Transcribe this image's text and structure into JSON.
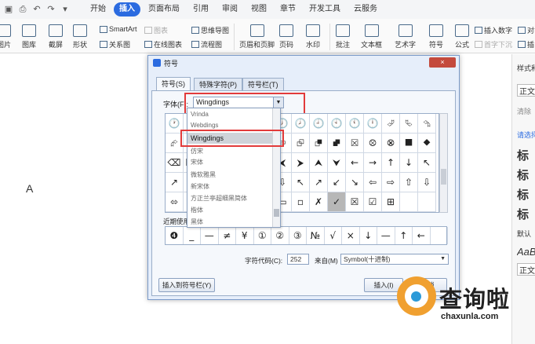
{
  "menubar": {
    "tabs": [
      "开始",
      "插入",
      "页面布局",
      "引用",
      "审阅",
      "视图",
      "章节",
      "开发工具",
      "云服务"
    ],
    "active_tab": "插入"
  },
  "ribbon": {
    "picture": "图片",
    "gallery": "图库",
    "screenshot": "截屏",
    "shape": "形状",
    "smartart": "SmartArt",
    "chart": "图表",
    "relation_chart": "关系图",
    "online_chart": "在线图表",
    "mindmap": "思维导图",
    "flowchart": "流程图",
    "header_footer": "页眉和页脚",
    "page_number": "页码",
    "watermark": "水印",
    "comment": "批注",
    "textbox": "文本框",
    "wordart": "艺术字",
    "symbol": "符号",
    "formula": "公式",
    "insert_number": "插入数字",
    "attachment": "对象",
    "first_drop": "首字下沉",
    "bookmark": "插"
  },
  "document": {
    "text": "A"
  },
  "right_panel": {
    "title": "样式和",
    "body": "正文",
    "clear": "清除",
    "pick": "请选择",
    "heading_chars": [
      "标",
      "标",
      "标",
      "标"
    ],
    "default": "默认",
    "italic_sample": "AaB",
    "body2": "正文"
  },
  "dialog": {
    "title": "符号",
    "close_label": "×",
    "tabs": [
      "符号(S)",
      "特殊字符(P)",
      "符号栏(T)"
    ],
    "font_label": "字体(F):",
    "font_value": "Wingdings",
    "font_list": [
      "Vrinda",
      "Webdings",
      "Wingdings",
      "仿宋",
      "宋体",
      "微软雅黑",
      "新宋体",
      "方正兰亭超细黑简体",
      "楷体",
      "黑体"
    ],
    "symbols": [
      "🕐",
      "🕑",
      "🕒",
      "🕓",
      "🕔",
      "🕕",
      "🕖",
      "🕗",
      "🕘",
      "🕙",
      "🕚",
      "🕛",
      "⮰",
      "⮱",
      "⮲",
      "⮳",
      "⮴",
      "⮵",
      "⮶",
      "⮷",
      "⮸",
      "⮹",
      "⮺",
      "⮻",
      "⮼",
      "⮽",
      "⮾",
      "⮿",
      "⯀",
      "⯁",
      "⌫",
      "⌦",
      "⮘",
      "⮚",
      "⮙",
      "⮛",
      "⮜",
      "⮞",
      "⮝",
      "⮟",
      "←",
      "→",
      "↑",
      "↓",
      "↖",
      "↗",
      "↙",
      "↘",
      "⇦",
      "⇨",
      "⇧",
      "⇩",
      "↖",
      "↗",
      "↙",
      "↘",
      "⇦",
      "⇨",
      "⇧",
      "⇩",
      "⬄",
      "⇳",
      "⬀",
      "⬁",
      "⬃",
      "⬂",
      "▭",
      "▫",
      "✗",
      "✓",
      "☒",
      "☑",
      "⊞",
      "",
      ""
    ],
    "recent_label": "近期使用",
    "recent": [
      "❹",
      "_",
      "—",
      "≠",
      "¥",
      "①",
      "②",
      "③",
      "№",
      "√",
      "×",
      "↓",
      "—",
      "↑",
      "←",
      ""
    ],
    "char_code_label": "字符代码(C):",
    "char_code": "252",
    "from_label": "来自(M)",
    "from_value": "Symbol(十进制)",
    "insert_to_bar": "插入到符号栏(Y)",
    "insert": "插入(I)",
    "cancel": "取消"
  },
  "watermark": {
    "text": "查询啦",
    "url": "chaxunla.com"
  },
  "colors": {
    "accent": "#2b6be0",
    "highlight": "#e23b3b",
    "watermark_orange": "#f0a030"
  }
}
